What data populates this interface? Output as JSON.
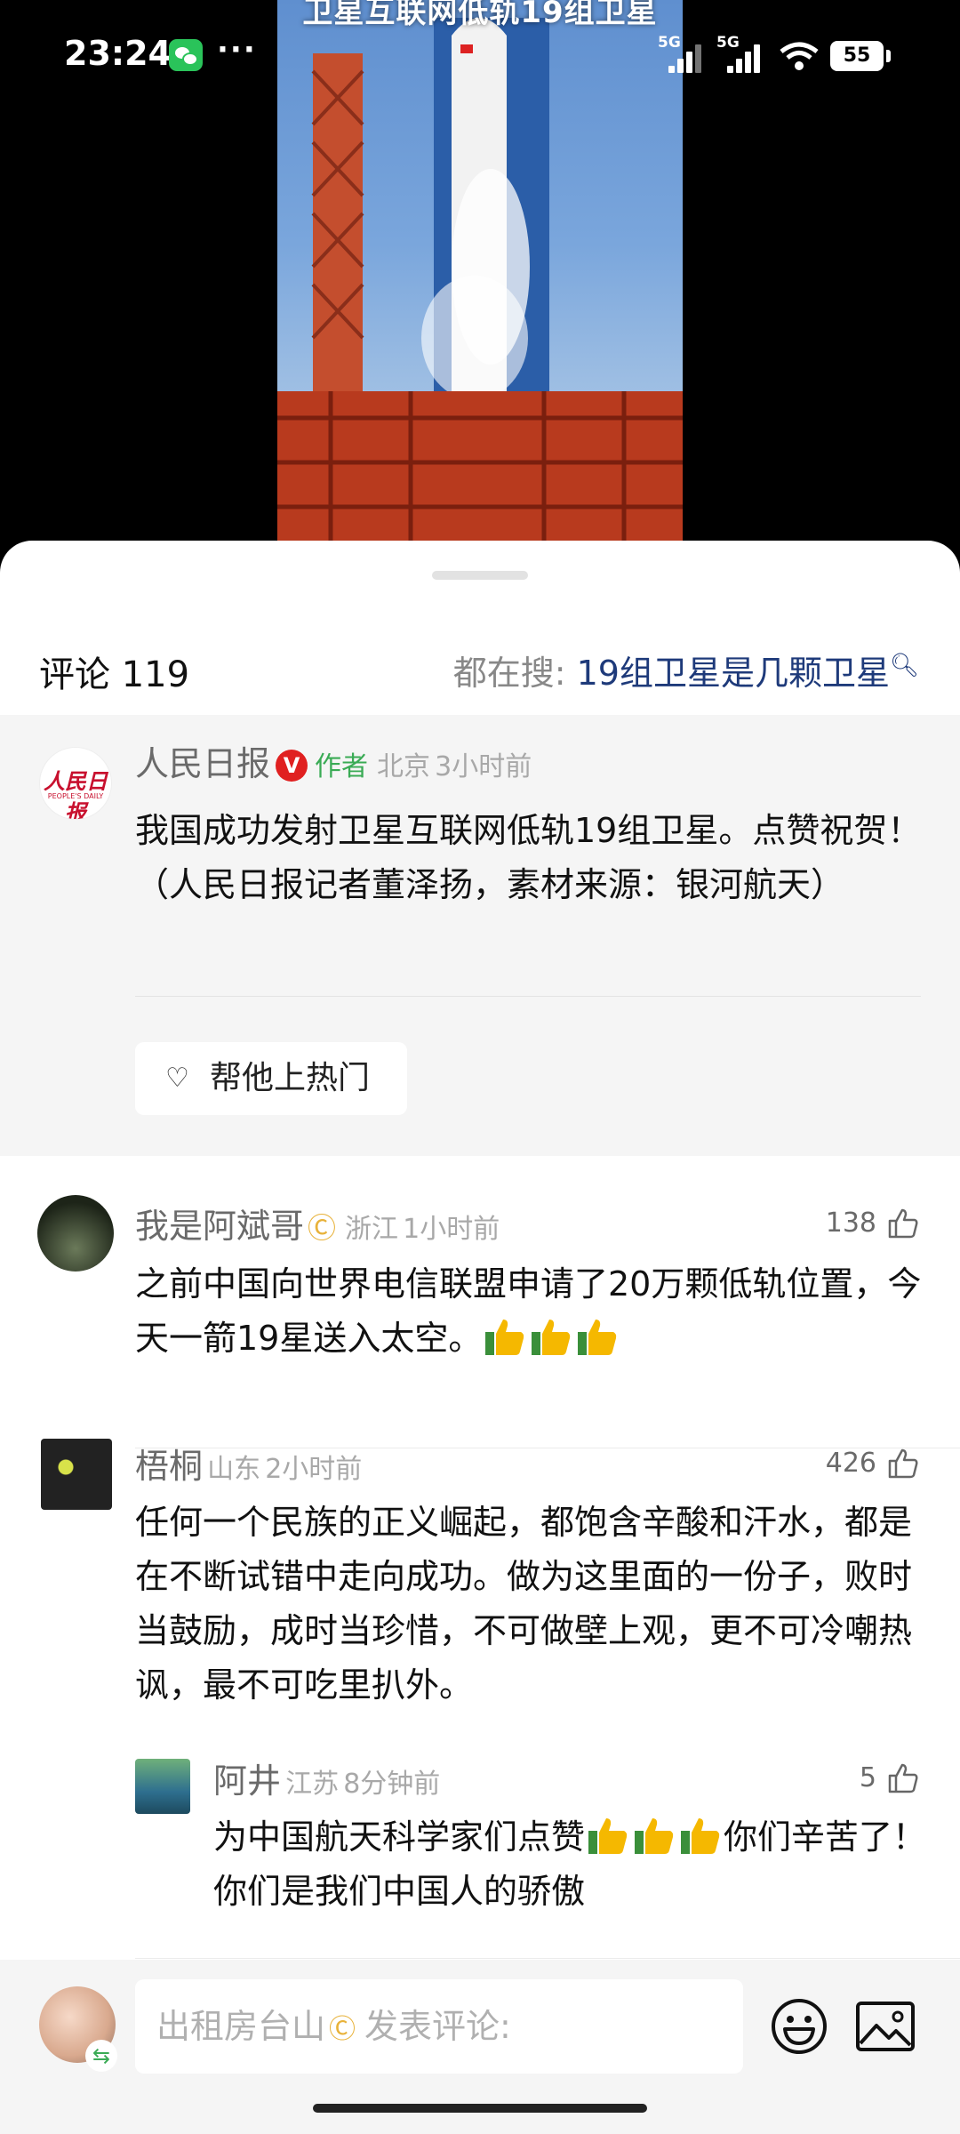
{
  "video": {
    "caption": "卫星互联网低轨19组卫星"
  },
  "status_bar": {
    "time": "23:24",
    "network_1": "5G",
    "network_2": "5G",
    "battery": "55"
  },
  "header": {
    "comment_label": "评论 119",
    "search_prefix": "都在搜:",
    "search_query": "19组卫星是几颗卫星"
  },
  "author_comment": {
    "user": "人民日报",
    "author_tag": "作者",
    "location": "北京",
    "time": "3小时前",
    "text": "我国成功发射卫星互联网低轨19组卫星。点赞祝贺！（人民日报记者董泽扬，素材来源：银河航天）",
    "boost_button": "帮他上热门"
  },
  "comments": [
    {
      "user": "我是阿斌哥",
      "location": "浙江",
      "time": "1小时前",
      "likes": "138",
      "text": "之前中国向世界电信联盟申请了20万颗低轨位置，今天一箭19星送入太空。"
    },
    {
      "user": "梧桐",
      "location": "山东",
      "time": "2小时前",
      "likes": "426",
      "text": "任何一个民族的正义崛起，都饱含辛酸和汗水，都是在不断试错中走向成功。做为这里面的一份子，败时当鼓励，成时当珍惜，不可做壁上观，更不可冷嘲热讽，最不可吃里扒外。"
    }
  ],
  "reply": {
    "user": "阿井",
    "location": "江苏",
    "time": "8分钟前",
    "likes": "5",
    "text_before": "为中国航天科学家们点赞",
    "text_after": "你们辛苦了！你们是我们中国人的骄傲"
  },
  "input_bar": {
    "nickname": "出租房台山",
    "placeholder": "发表评论:"
  }
}
